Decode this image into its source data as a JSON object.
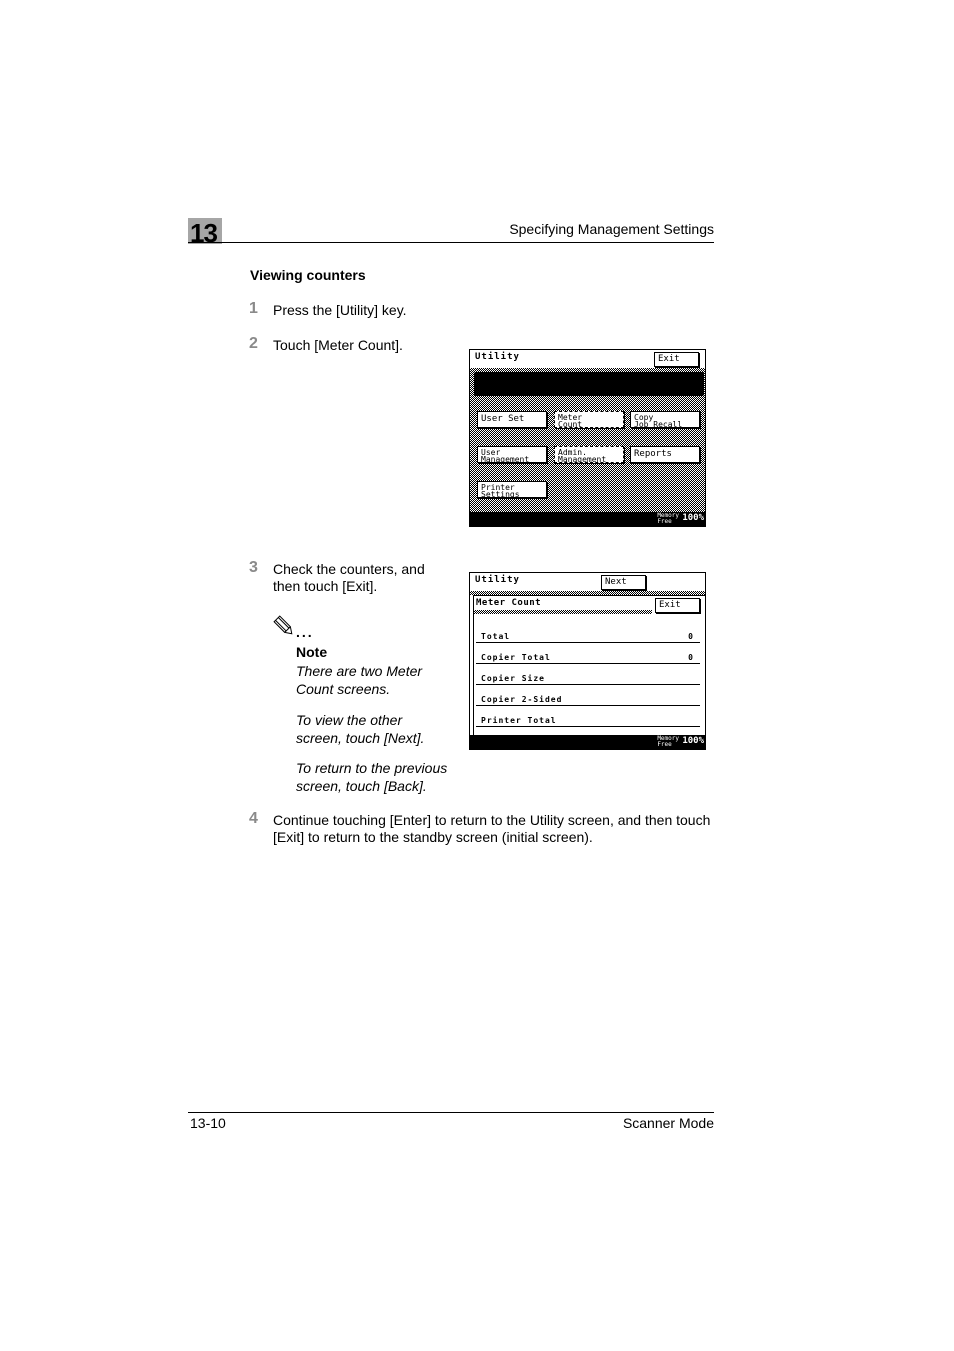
{
  "header": {
    "chapter_number": "13",
    "title": "Specifying Management Settings"
  },
  "section_title": "Viewing counters",
  "steps": [
    {
      "num": "1",
      "text": "Press the [Utility] key."
    },
    {
      "num": "2",
      "text": "Touch [Meter Count]."
    },
    {
      "num": "3",
      "text_line1": "Check the counters, and",
      "text_line2": "then touch [Exit]."
    },
    {
      "num": "4",
      "text_line1": "Continue touching [Enter] to return to the Utility screen, and then touch",
      "text_line2": "[Exit] to return to the standby screen (initial screen)."
    }
  ],
  "note": {
    "icon": "pencil-icon",
    "dots": "...",
    "title": "Note",
    "paragraphs": [
      {
        "line1": "There are two Meter",
        "line2": "Count screens."
      },
      {
        "line1": "To view the other",
        "line2": "screen, touch [Next]."
      },
      {
        "line1": "To return to the previous",
        "line2": "screen, touch [Back]."
      }
    ]
  },
  "screen1": {
    "title": "Utility",
    "exit_label": "Exit",
    "buttons": [
      {
        "line1": "User Set",
        "line2": ""
      },
      {
        "line1": "Meter",
        "line2": "Count"
      },
      {
        "line1": "Copy",
        "line2": "Job Recall"
      },
      {
        "line1": "User",
        "line2": "Management"
      },
      {
        "line1": "Admin.",
        "line2": "Management"
      },
      {
        "line1": "Reports",
        "line2": ""
      },
      {
        "line1": "Printer",
        "line2": "Settings"
      }
    ],
    "memory_label_1": "Memory",
    "memory_label_2": "Free",
    "memory_value": "100%"
  },
  "screen2": {
    "title": "Utility",
    "next_label": "Next",
    "subtitle": "Meter Count",
    "exit_label": "Exit",
    "rows": [
      {
        "label": "Total",
        "value": "0"
      },
      {
        "label": "Copier Total",
        "value": "0"
      },
      {
        "label": "Copier Size",
        "value": ""
      },
      {
        "label": "Copier 2-Sided",
        "value": ""
      },
      {
        "label": "Printer Total",
        "value": ""
      }
    ],
    "memory_label_1": "Memory",
    "memory_label_2": "Free",
    "memory_value": "100%"
  },
  "footer": {
    "page_number": "13-10",
    "section": "Scanner Mode"
  }
}
